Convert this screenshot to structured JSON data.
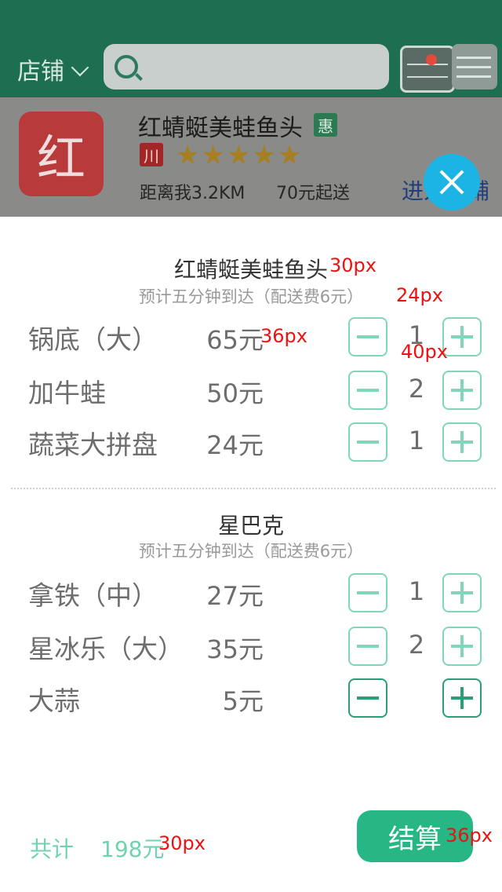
{
  "header": {
    "store_label": "店铺"
  },
  "store_card": {
    "logo_char": "红",
    "name": "红蜻蜓美蛙鱼头",
    "promo_badge": "惠",
    "cuisine_badge": "川",
    "stars": "★★★★★",
    "rating": 5,
    "distance": "距离我3.2KM",
    "min_order": "70元起送",
    "enter_store": "进入店铺"
  },
  "shops": [
    {
      "title": "红蜻蜓美蛙鱼头",
      "subtitle": "预计五分钟到达（配送费6元）",
      "items": [
        {
          "name": "锅底（大）",
          "price": "65元",
          "qty": "1"
        },
        {
          "name": "加牛蛙",
          "price": "50元",
          "qty": "2"
        },
        {
          "name": "蔬菜大拼盘",
          "price": "24元",
          "qty": "1"
        }
      ]
    },
    {
      "title": "星巴克",
      "subtitle": "预计五分钟到达（配送费6元）",
      "items": [
        {
          "name": "拿铁（中）",
          "price": "27元",
          "qty": "1"
        },
        {
          "name": "星冰乐（大）",
          "price": "35元",
          "qty": "2"
        },
        {
          "name": "大蒜",
          "price": "5元",
          "qty": ""
        }
      ]
    }
  ],
  "annotations": {
    "title_size": "30px",
    "subtitle_size": "24px",
    "price_size": "36px",
    "qty_size": "40px",
    "total_size": "30px",
    "checkout_size": "36px"
  },
  "footer": {
    "total_label": "共计",
    "total_value": "198元",
    "checkout_label": "结算"
  },
  "colors": {
    "header": "#1e6e52",
    "accent_green": "#26b784",
    "qty_border": "#80d6b9",
    "close_button": "#1cb4e4",
    "annotation": "#ee1111"
  }
}
